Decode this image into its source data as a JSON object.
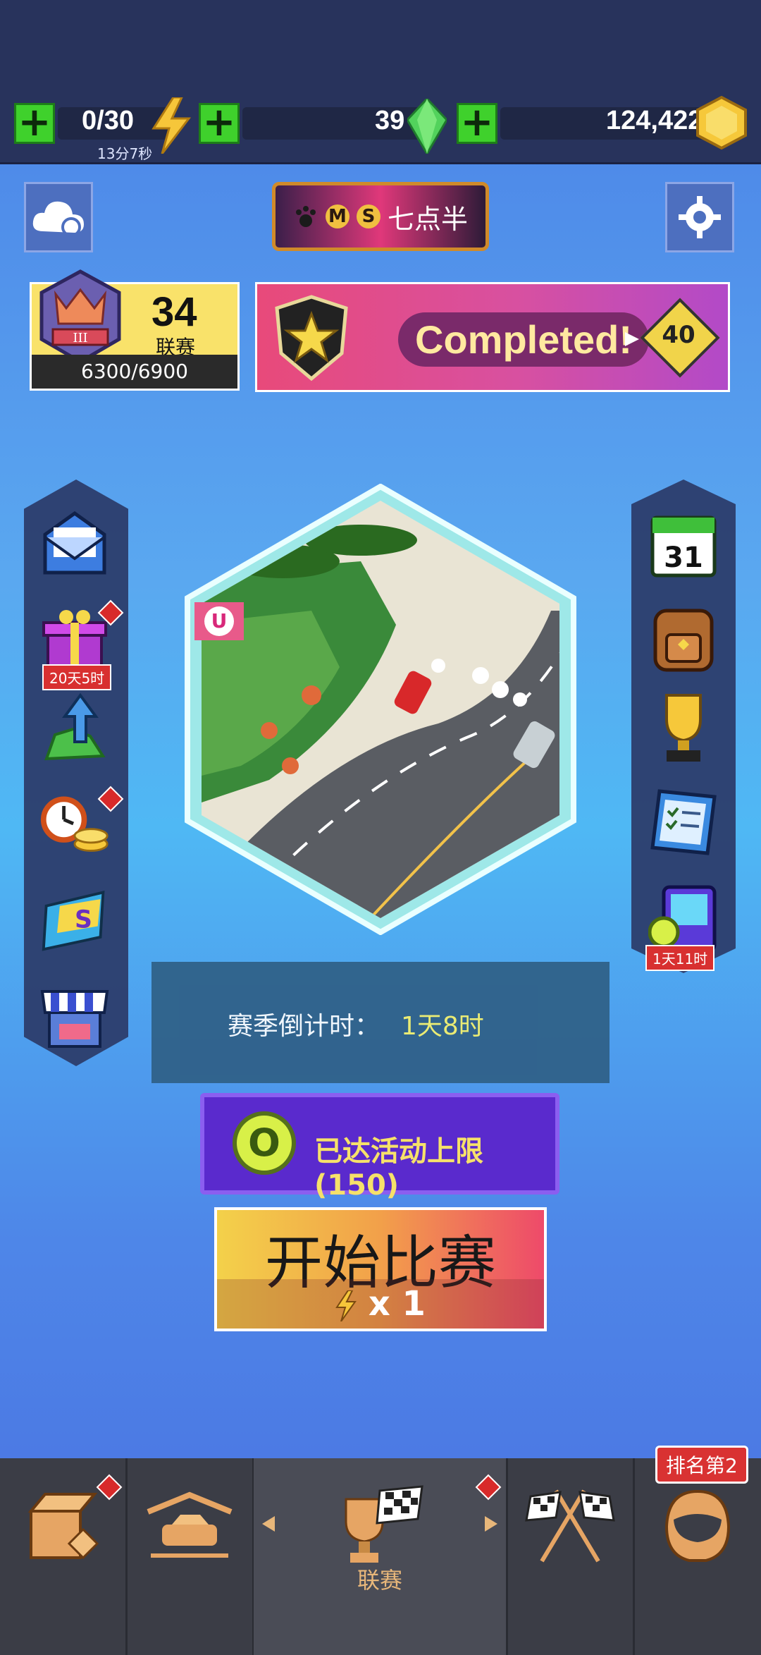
{
  "resources": {
    "energy": {
      "value": "0/30",
      "timer": "13分7秒"
    },
    "gems": {
      "value": "39"
    },
    "coins": {
      "value": "124,422"
    }
  },
  "player": {
    "badge_letters": [
      "M",
      "S"
    ],
    "name": "七点半"
  },
  "league": {
    "rank_level": "34",
    "label": "联赛",
    "progress": "6300/6900",
    "tier": "III"
  },
  "quest_banner": {
    "text": "Completed!",
    "reward": "40"
  },
  "left_sidebar": {
    "items": [
      {
        "name": "mail"
      },
      {
        "name": "gift",
        "tag": "20天5时"
      },
      {
        "name": "gem-upgrade"
      },
      {
        "name": "timed-offer"
      },
      {
        "name": "season-pass"
      },
      {
        "name": "shop"
      }
    ]
  },
  "right_sidebar": {
    "items": [
      {
        "name": "calendar",
        "text": "31"
      },
      {
        "name": "backpack"
      },
      {
        "name": "trophy"
      },
      {
        "name": "checklist"
      },
      {
        "name": "arcade",
        "tag": "1天11时"
      }
    ]
  },
  "track_badge": "U",
  "season": {
    "label": "赛季倒计时：",
    "value": "1天8时"
  },
  "event": {
    "coin_symbol": "O",
    "text": "已达活动上限(150)"
  },
  "start": {
    "label": "开始比赛",
    "cost": "x 1"
  },
  "nav": {
    "active_label": "联赛",
    "rank_badge": "排名第2"
  },
  "colors": {
    "accent_green": "#3fd12c",
    "topbar": "#28335c",
    "navbar": "#3b3d46",
    "event_purple": "#5a2acd"
  }
}
